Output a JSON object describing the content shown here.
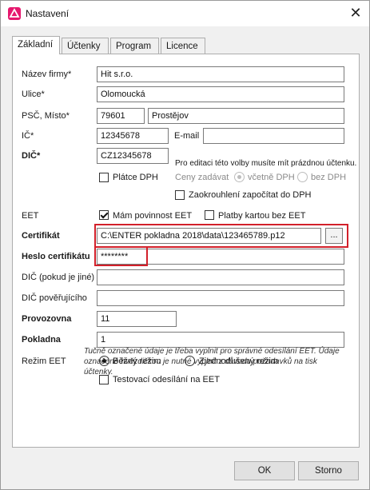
{
  "window": {
    "title": "Nastavení"
  },
  "icons": {
    "app": "app-logo-icon",
    "close": "close-icon"
  },
  "tabs": [
    "Základní",
    "Účtenky",
    "Program",
    "Licence"
  ],
  "fields": {
    "firma": {
      "label": "Název firmy*",
      "value": "Hit s.r.o."
    },
    "ulice": {
      "label": "Ulice*",
      "value": "Olomoucká"
    },
    "psc": {
      "label": "PSČ, Místo*",
      "value": "79601",
      "misto": "Prostějov"
    },
    "ic": {
      "label": "IČ*",
      "value": "12345678",
      "email_label": "E-mail",
      "email_value": ""
    },
    "dic": {
      "label": "DIČ*",
      "value": "CZ12345678",
      "hint": "Pro editaci této volby musíte mít prázdnou účtenku."
    },
    "platce_dph": {
      "label": "Plátce DPH",
      "checked": false
    },
    "ceny": {
      "label": "Ceny zadávat",
      "opt1": "včetně DPH",
      "opt2": "bez DPH"
    },
    "zaokrouhleni": {
      "label": "Zaokrouhlení započítat do DPH",
      "checked": false
    },
    "eet": {
      "label": "EET",
      "povinnost": "Mám povinnost EET",
      "platby": "Platby kartou bez EET"
    },
    "certifikat": {
      "label": "Certifikát",
      "value": "C:\\ENTER pokladna 2018\\data\\123465789.p12",
      "browse": "..."
    },
    "heslo": {
      "label": "Heslo certifikátu",
      "value": "********"
    },
    "dic_jine": {
      "label": "DIČ (pokud je jiné)",
      "value": ""
    },
    "dic_poverujici": {
      "label": "DIČ pověřujícího",
      "value": ""
    },
    "provozovna": {
      "label": "Provozovna",
      "value": "11"
    },
    "pokladna": {
      "label": "Pokladna",
      "value": "1"
    },
    "rezim": {
      "label": "Režim EET",
      "opt1": "Běžný režim",
      "opt2": "Zjednodušený režim"
    },
    "testovaci": {
      "label": "Testovací odesílání na EET",
      "checked": false
    }
  },
  "note": "Tučně označené údaje je třeba vyplnit pro správné odesílání EET. Údaje označené hvězdičkou je nutné vyplnit z důvodu požadavků na tisk účtenky.",
  "buttons": {
    "ok": "OK",
    "cancel": "Storno"
  }
}
